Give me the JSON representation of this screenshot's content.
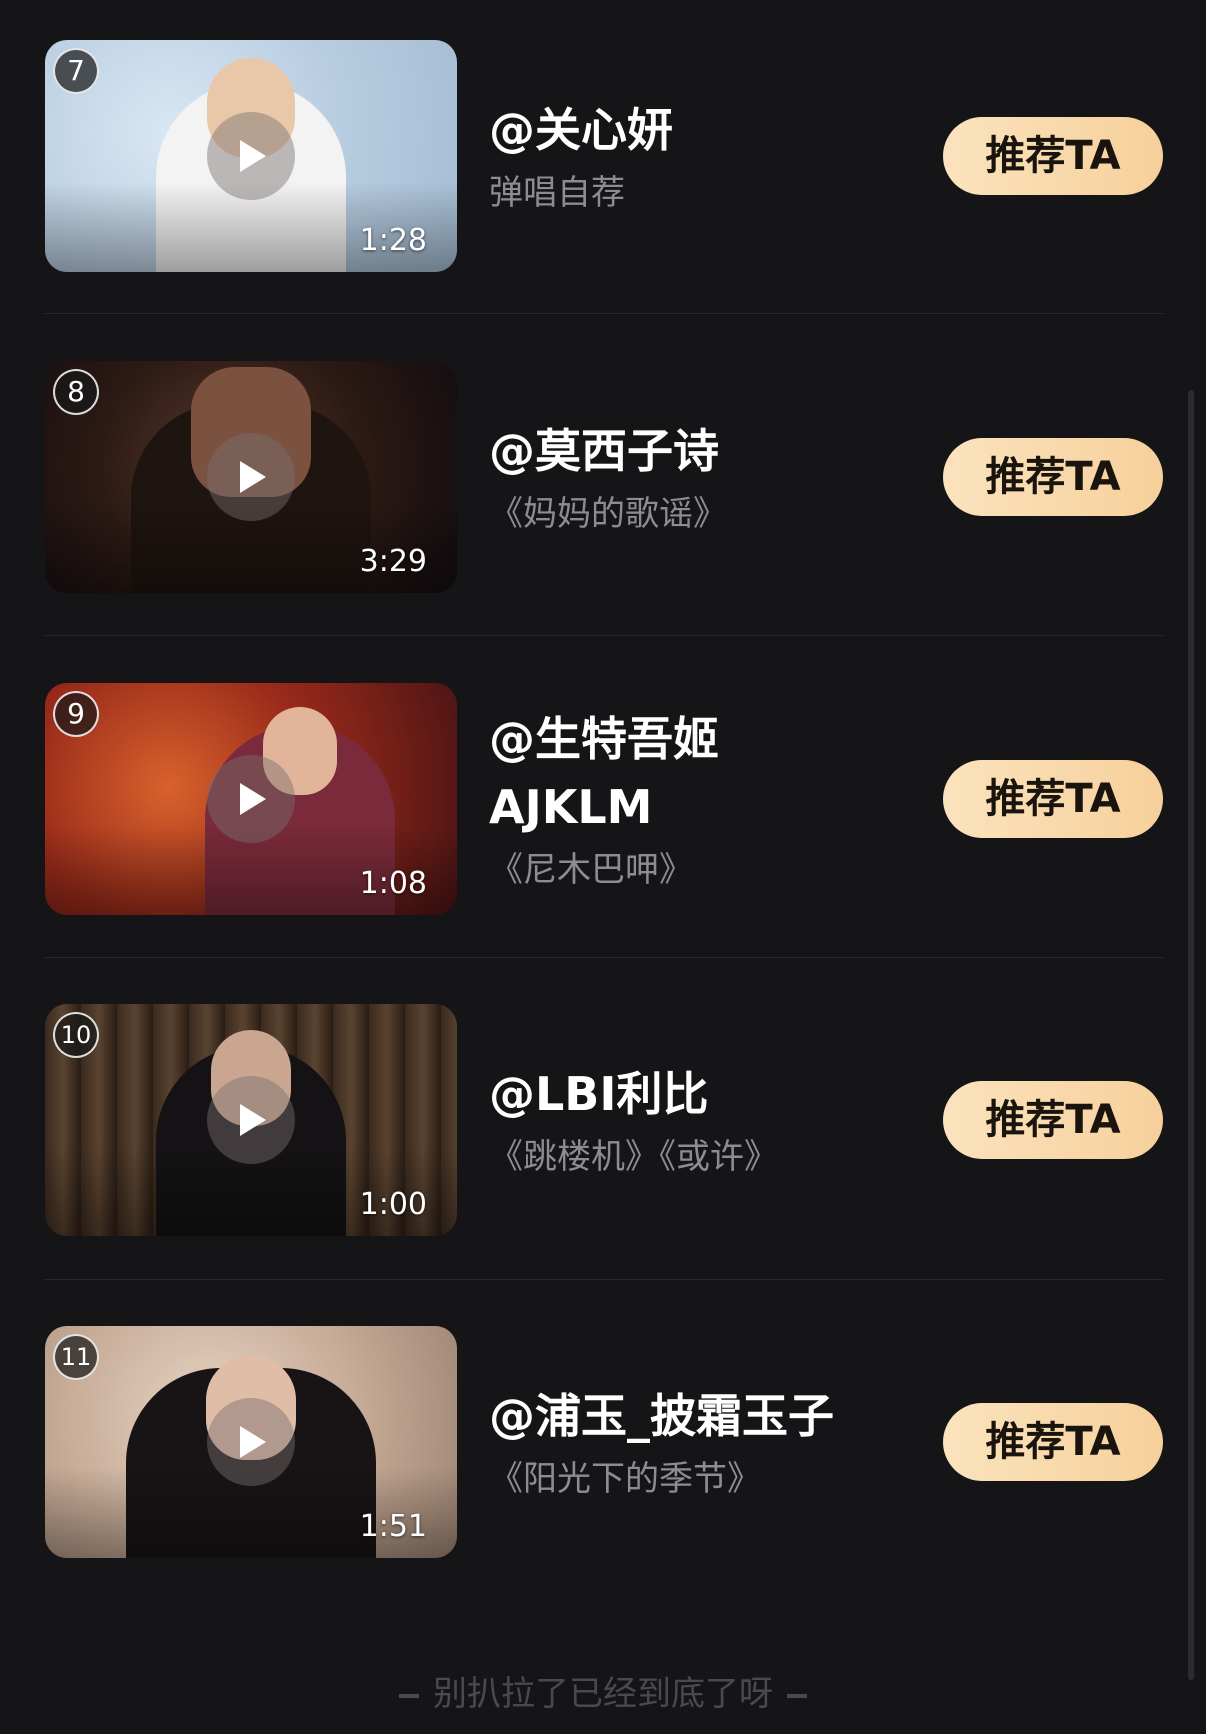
{
  "list": {
    "items": [
      {
        "rank": "7",
        "name": "@关心妍",
        "subtitle": "弹唱自荐",
        "duration": "1:28",
        "button": "推荐TA"
      },
      {
        "rank": "8",
        "name": "@莫西子诗",
        "subtitle": "《妈妈的歌谣》",
        "duration": "3:29",
        "button": "推荐TA"
      },
      {
        "rank": "9",
        "name": "@生特吾姬\nAJKLM",
        "name_line1": "@生特吾姬",
        "name_line2": "AJKLM",
        "subtitle": "《尼木巴呷》",
        "duration": "1:08",
        "button": "推荐TA"
      },
      {
        "rank": "10",
        "name": "@LBI利比",
        "subtitle": "《跳楼机》《或许》",
        "duration": "1:00",
        "button": "推荐TA"
      },
      {
        "rank": "11",
        "name": "@浦玉_披霜玉子",
        "subtitle": "《阳光下的季节》",
        "duration": "1:51",
        "button": "推荐TA"
      }
    ]
  },
  "footer": {
    "text": "别扒拉了已经到底了呀"
  },
  "icons": {
    "play": "play-icon"
  },
  "colors": {
    "background": "#151416",
    "button_gradient_start": "#fbe3bd",
    "button_gradient_end": "#f6d09b",
    "subtitle": "#8d8c90"
  }
}
